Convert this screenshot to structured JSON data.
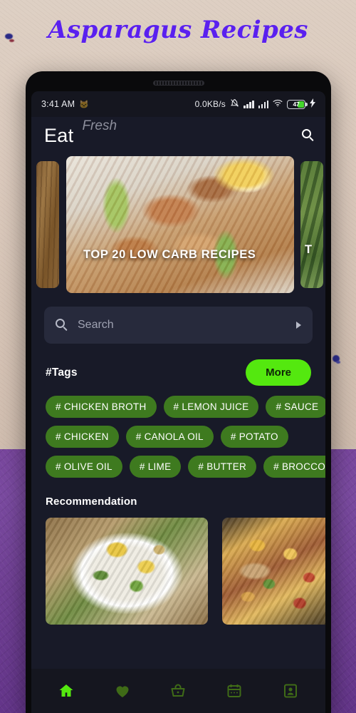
{
  "page": {
    "title": "Asparagus Recipes",
    "title_color": "#5a20ef",
    "background_top_color": "#d9c9bb",
    "background_bottom_color": "#74449b"
  },
  "device": {
    "frame_color": "#0a0a0c",
    "screen_background": "#181a28"
  },
  "statusbar": {
    "time": "3:41 AM",
    "network_speed": "0.0KB/s",
    "battery_level": "47",
    "battery_charging": true,
    "icons": [
      "cat-icon",
      "notifications-off-icon",
      "signal-bars-icon",
      "signal-bars-icon",
      "wifi-icon",
      "battery-icon",
      "charging-bolt-icon"
    ]
  },
  "appbar": {
    "brand": "Eat",
    "brand_sub": "Fresh",
    "search_icon": "search-icon"
  },
  "carousel": {
    "slides": [
      {
        "title": "",
        "image": "wood-board-photo"
      },
      {
        "title": "TOP 20 LOW CARB RECIPES",
        "image": "bacon-wrapped-asparagus-photo"
      },
      {
        "title": "T",
        "image": "grilled-asparagus-photo"
      }
    ],
    "active_index": 1
  },
  "search": {
    "placeholder": "Search",
    "value": "",
    "icon": "search-icon",
    "submit_icon": "play-arrow-icon"
  },
  "tags": {
    "heading": "#Tags",
    "more_label": "More",
    "more_color": "#54e80f",
    "pill_color": "#3e7a1f",
    "rows": [
      [
        "# CHICKEN BROTH",
        "# LEMON JUICE",
        "# SAUCE"
      ],
      [
        "# CHICKEN",
        "# CANOLA OIL",
        "# POTATO"
      ],
      [
        "# OLIVE OIL",
        "# LIME",
        "# BUTTER",
        "# BROCCOLI"
      ]
    ]
  },
  "recommendation": {
    "heading": "Recommendation",
    "cards": [
      {
        "image": "tofu-asparagus-rice-bowl-photo"
      },
      {
        "image": "pasta-skillet-photo"
      }
    ]
  },
  "bottomnav": {
    "active_color": "#54e80f",
    "inactive_color": "#3f6b17",
    "items": [
      {
        "icon": "home-icon",
        "active": true
      },
      {
        "icon": "heart-icon",
        "active": false
      },
      {
        "icon": "basket-icon",
        "active": false
      },
      {
        "icon": "calendar-icon",
        "active": false
      },
      {
        "icon": "profile-icon",
        "active": false
      }
    ]
  }
}
